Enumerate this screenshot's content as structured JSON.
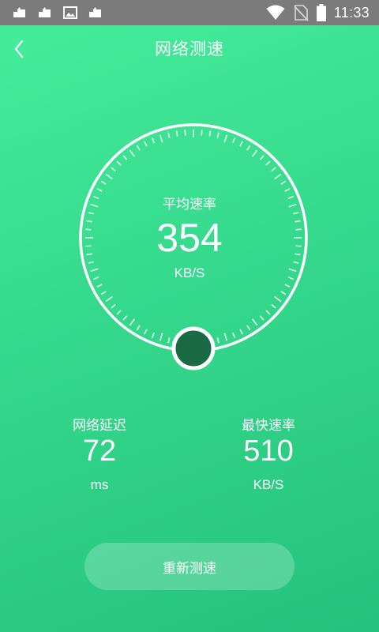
{
  "status_bar": {
    "notifications": [
      "notification-icon",
      "notification-icon",
      "image-notification-icon",
      "notification-icon"
    ],
    "time": "11:33"
  },
  "header": {
    "title": "网络测速",
    "back_icon": "chevron-left-icon"
  },
  "gauge": {
    "average_label": "平均速率",
    "average_value": "354",
    "average_unit": "KB/S"
  },
  "stats": {
    "latency": {
      "label": "网络延迟",
      "value": "72",
      "unit": "ms"
    },
    "max_speed": {
      "label": "最快速率",
      "value": "510",
      "unit": "KB/S"
    }
  },
  "actions": {
    "retest_label": "重新测速"
  },
  "colors": {
    "gradient_top": "#46ee9b",
    "gradient_bottom": "#24c27c",
    "indicator": "#196a45",
    "status_bar": "#7b7b7b"
  }
}
